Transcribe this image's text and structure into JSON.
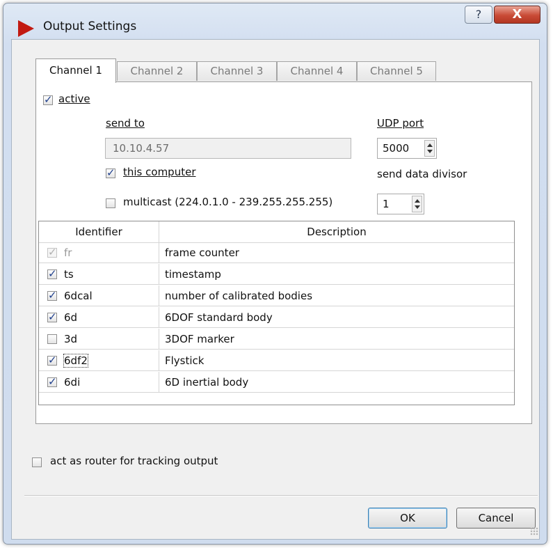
{
  "window": {
    "title": "Output Settings",
    "help_label": "?",
    "close_label": "X"
  },
  "tabs": [
    {
      "label": "Channel 1",
      "active": true
    },
    {
      "label": "Channel 2",
      "active": false
    },
    {
      "label": "Channel 3",
      "active": false
    },
    {
      "label": "Channel 4",
      "active": false
    },
    {
      "label": "Channel 5",
      "active": false
    }
  ],
  "channel": {
    "active": {
      "label": "active",
      "checked": true
    },
    "send_to_label": "send to",
    "send_to_value": "10.10.4.57",
    "this_computer": {
      "label": "this computer",
      "checked": true
    },
    "multicast": {
      "label": "multicast (224.0.1.0 - 239.255.255.255)",
      "checked": false
    },
    "udp_port_label": "UDP port",
    "udp_port_value": "5000",
    "divisor_label": "send data divisor",
    "divisor_value": "1"
  },
  "table": {
    "headers": {
      "identifier": "Identifier",
      "description": "Description"
    },
    "rows": [
      {
        "id": "fr",
        "description": "frame counter",
        "checked": true,
        "disabled": true
      },
      {
        "id": "ts",
        "description": "timestamp",
        "checked": true,
        "disabled": false
      },
      {
        "id": "6dcal",
        "description": "number of calibrated bodies",
        "checked": true,
        "disabled": false
      },
      {
        "id": "6d",
        "description": "6DOF standard body",
        "checked": true,
        "disabled": false
      },
      {
        "id": "3d",
        "description": "3DOF marker",
        "checked": false,
        "disabled": false
      },
      {
        "id": "6df2",
        "description": "Flystick",
        "checked": true,
        "disabled": false,
        "focused": true
      },
      {
        "id": "6di",
        "description": "6D inertial body",
        "checked": true,
        "disabled": false
      }
    ]
  },
  "router": {
    "label": "act as router for tracking output",
    "checked": false
  },
  "buttons": {
    "ok": "OK",
    "cancel": "Cancel"
  },
  "colors": {
    "accent_icon": "#c21a12",
    "close_button": "#c94b36",
    "check_mark": "#1f3f8c"
  }
}
